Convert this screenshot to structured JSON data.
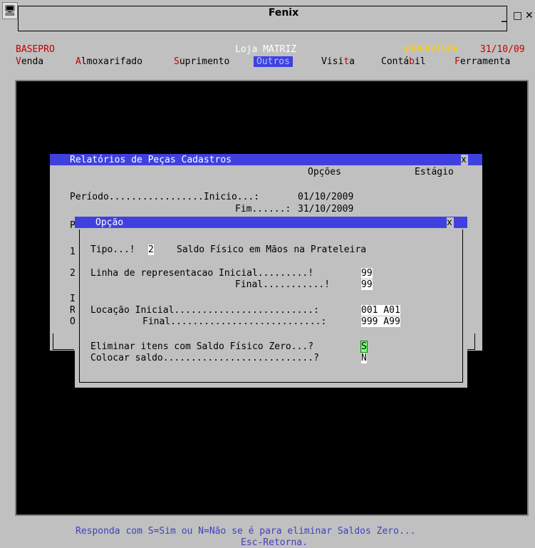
{
  "window": {
    "title": "Fenix",
    "min": "_",
    "max": "□",
    "close": "✕"
  },
  "header": {
    "company": "BASEPRO",
    "store": "Loja MATRIZ",
    "user": "SUPERVISOR",
    "date": "31/10/09"
  },
  "menu": {
    "items": [
      {
        "hot": "V",
        "rest": "enda"
      },
      {
        "hot": "A",
        "rest": "lmoxarifado"
      },
      {
        "hot": "S",
        "rest": "uprimento"
      },
      {
        "label": "Outros"
      },
      {
        "pre": "Visi",
        "hot": "t",
        "post": "a"
      },
      {
        "pre": "Contá",
        "hot": "b",
        "post": "il"
      },
      {
        "hot": "F",
        "rest": "erramenta"
      }
    ]
  },
  "panel": {
    "title": "Relatórios de Peças Cadastros",
    "close": "x",
    "tab_opcoes": "Opções",
    "tab_estagio": "Estágio",
    "periodo_label": "Período.................Inicio...: ",
    "periodo_inicio": "01/10/2009",
    "fim_label": "Fim......: ",
    "periodo_fim": "31/10/2009",
    "left_col": [
      "P",
      "1",
      "2",
      "I",
      "R",
      "O"
    ]
  },
  "dialog": {
    "title": "Opção",
    "close": "x",
    "tipo_label": "Tipo...!",
    "tipo_value": "2",
    "tipo_desc": "Saldo Físico em Mãos na Prateleira",
    "linha_label": "Linha de representacao Inicial.........!",
    "linha_inicial": "99",
    "linha_final_label": "Final...........!",
    "linha_final": "99",
    "locacao_label": "Locação Inicial.........................:",
    "locacao_inicial": "001 A01",
    "locacao_final_label": "Final...........................:",
    "locacao_final": "999 A99",
    "eliminar_label": "Eliminar itens com Saldo Físico Zero...?",
    "eliminar_value": "S",
    "colocar_label": "Colocar saldo...........................?",
    "colocar_value": "N"
  },
  "status": {
    "line1": "Responda com S=Sim ou N=Não se é para eliminar Saldos Zero...",
    "line2": "Esc-Retorna."
  },
  "colors": {
    "title_blue": "#4040e0",
    "hotkey_red": "#c00000",
    "status_blue": "#4040c0",
    "user_yellow": "#ffd000",
    "menu_selected": "#4040e0"
  }
}
